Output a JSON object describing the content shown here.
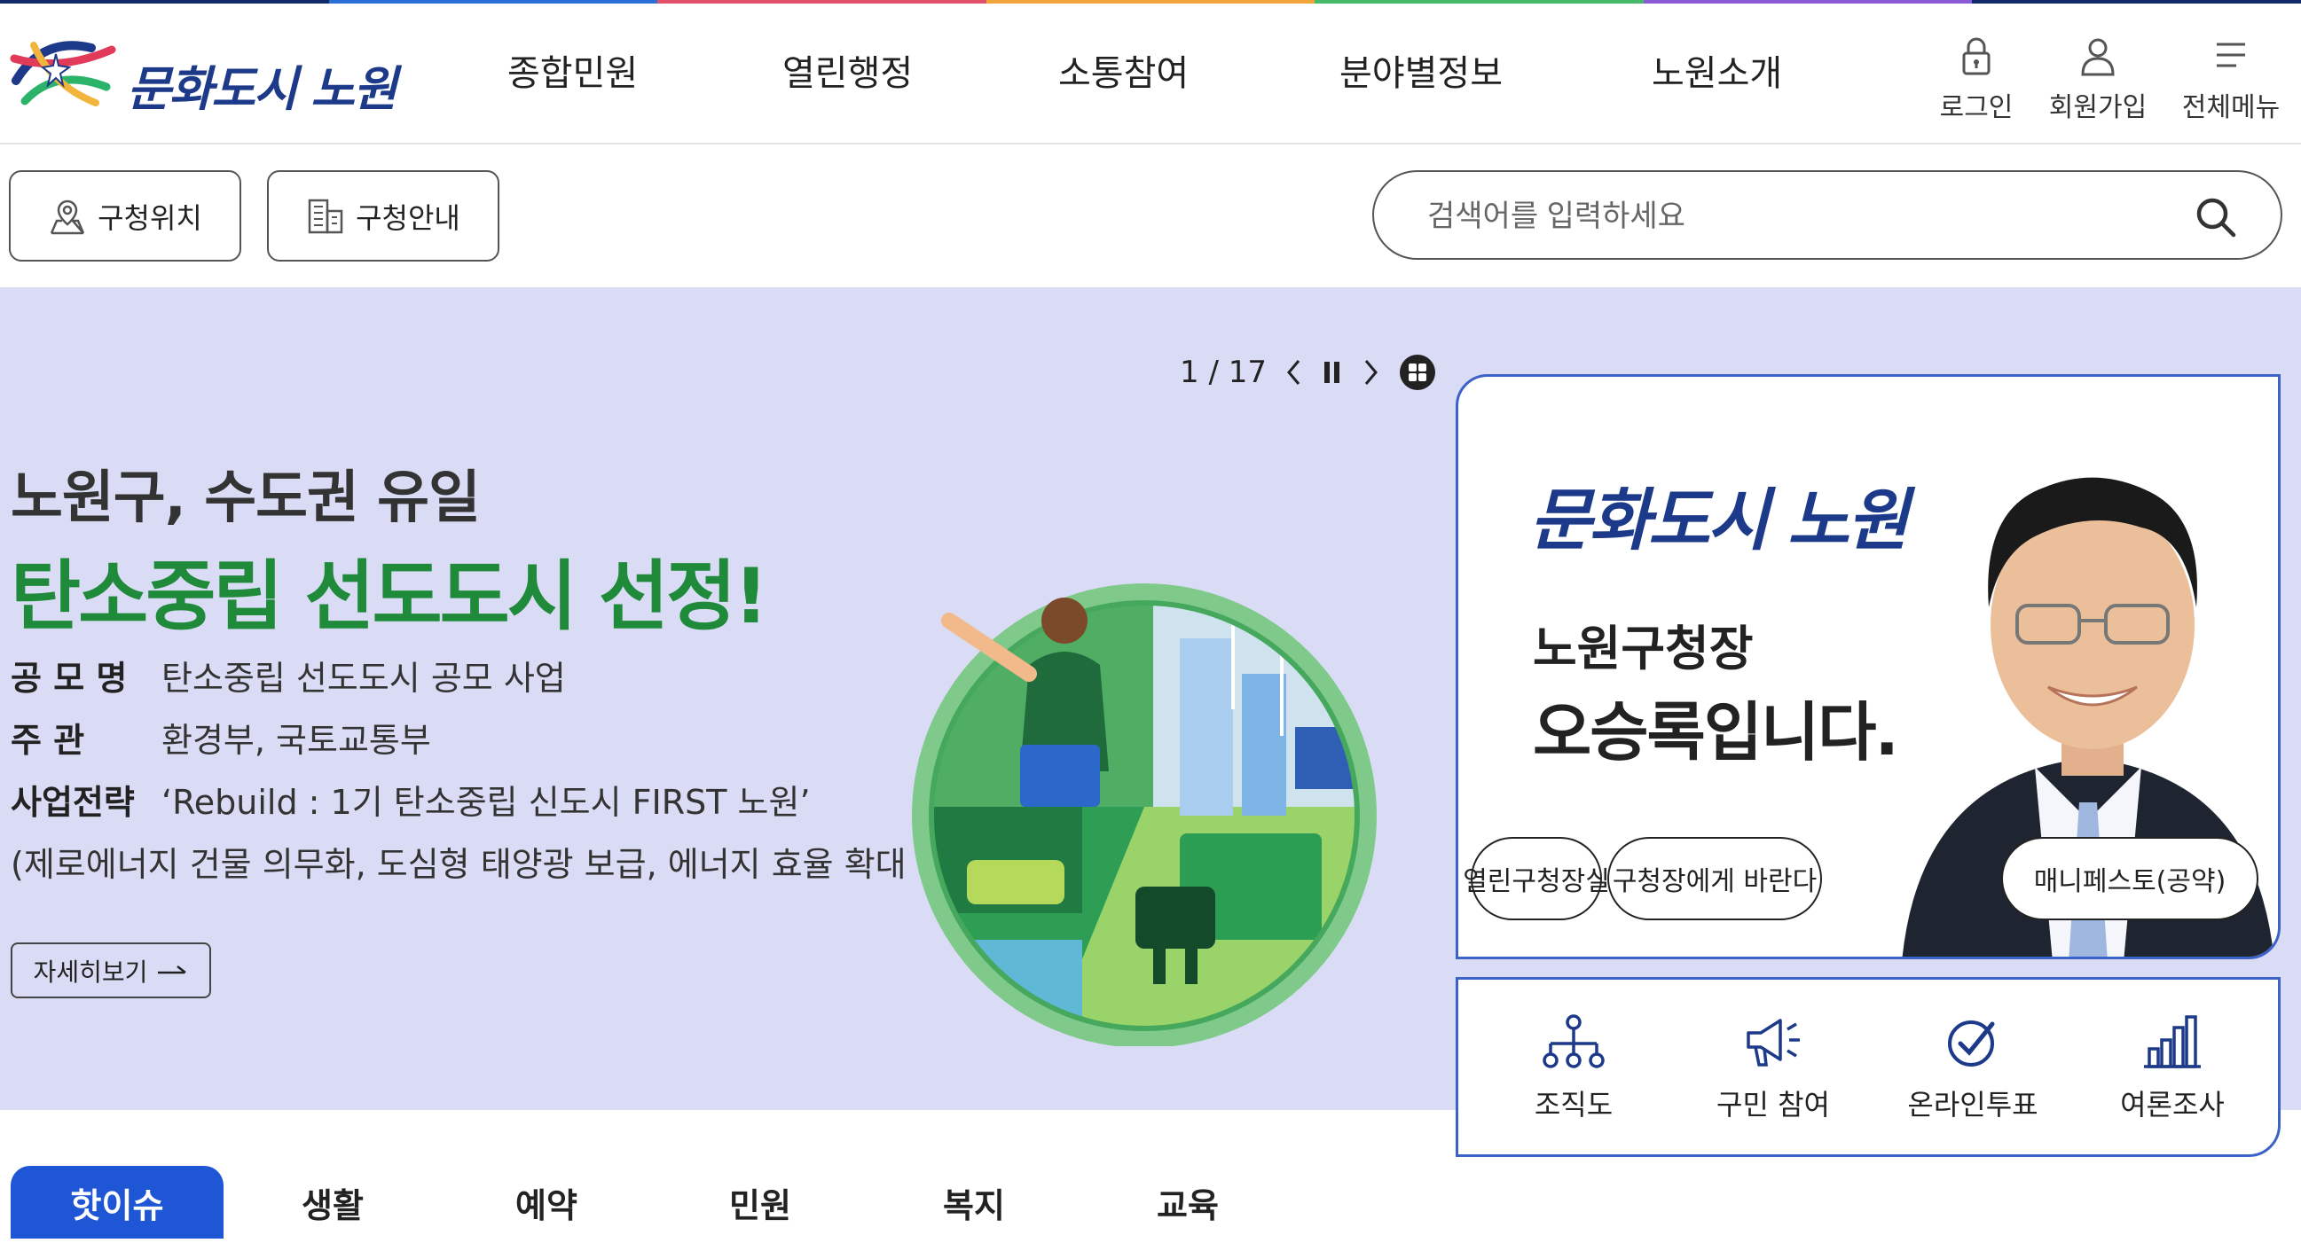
{
  "colors": {
    "brand_navy": "#1d3a8a",
    "accent_blue": "#1e56d6",
    "hero_bg": "#dadcf6",
    "headline_green": "#1e8a3a",
    "card_border": "#3a62c8"
  },
  "header": {
    "logo_text": "문화도시 노원",
    "nav": [
      "종합민원",
      "열린행정",
      "소통참여",
      "분야별정보",
      "노원소개"
    ],
    "util": {
      "login": "로그인",
      "signup": "회원가입",
      "all_menu": "전체메뉴"
    }
  },
  "toolbar": {
    "location_label": "구청위치",
    "guide_label": "구청안내",
    "search_placeholder": "검색어를 입력하세요"
  },
  "hero": {
    "pager": "1 / 17",
    "headline1": "노원구, 수도권 유일",
    "headline2": "탄소중립 선도도시 선정!",
    "rows": [
      {
        "label": "공 모 명",
        "value": "탄소중립 선도도시 공모 사업"
      },
      {
        "label": "주 관",
        "value": "환경부, 국토교통부"
      },
      {
        "label": "사업전략",
        "value": "‘Rebuild : 1기 탄소중립 신도시 FIRST 노원’"
      }
    ],
    "note": "(제로에너지 건물 의무화, 도심형 태양광 보급, 에너지 효율 확대 등)",
    "detail_label": "자세히보기"
  },
  "mayor": {
    "logo_text": "문화도시 노원",
    "title": "노원구청장",
    "name": "오승록입니다.",
    "buttons": [
      "열린구청장실",
      "구청장에게 바란다",
      "매니페스토(공약)"
    ]
  },
  "quick_links": [
    {
      "label": "조직도",
      "icon": "org-chart-icon"
    },
    {
      "label": "구민 참여",
      "icon": "megaphone-icon"
    },
    {
      "label": "온라인투표",
      "icon": "check-circle-icon"
    },
    {
      "label": "여론조사",
      "icon": "bar-chart-icon"
    }
  ],
  "tabs": [
    "핫이슈",
    "생활",
    "예약",
    "민원",
    "복지",
    "교육"
  ],
  "active_tab": "핫이슈"
}
